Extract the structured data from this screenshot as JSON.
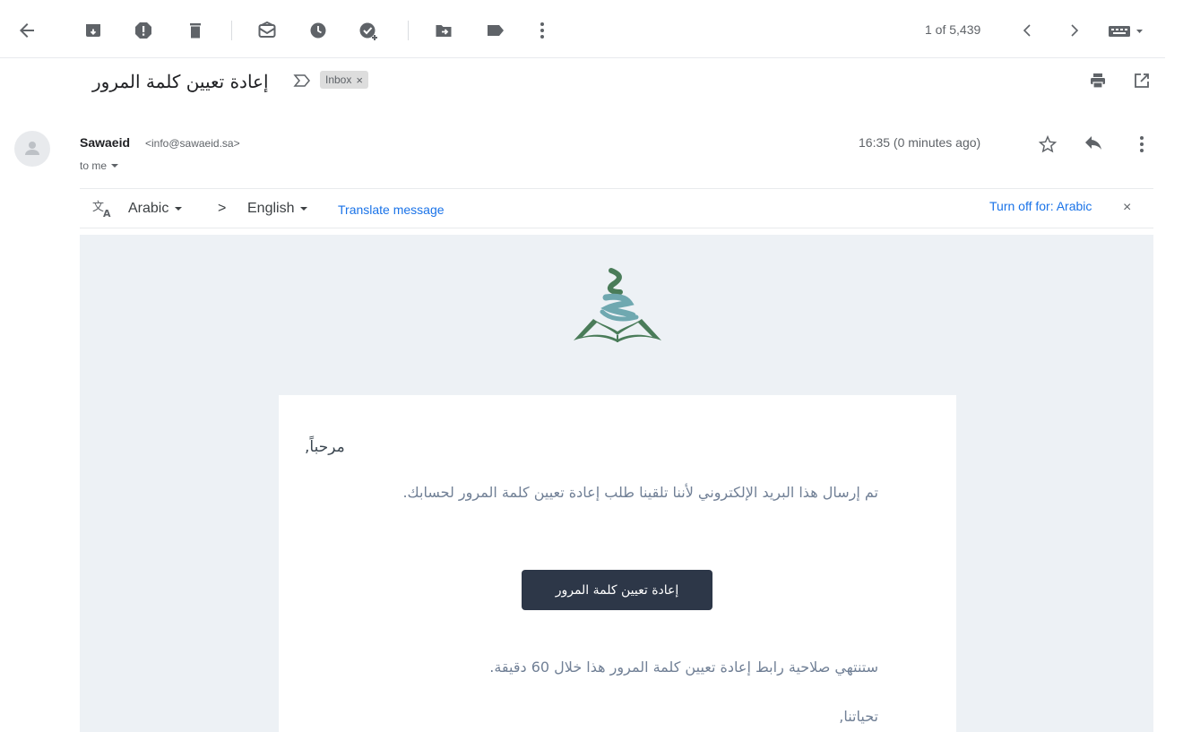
{
  "toolbar": {
    "pagination": "1 of 5,439"
  },
  "subject": {
    "text": "إعادة تعيين كلمة المرور",
    "label_chip": "Inbox",
    "chip_close": "×"
  },
  "message": {
    "sender_name": "Sawaeid",
    "sender_email": "<info@sawaeid.sa>",
    "recipient": "to me",
    "time": "16:35 (0 minutes ago)"
  },
  "translate_bar": {
    "from_lang": "Arabic",
    "arrow": ">",
    "to_lang": "English",
    "translate_link": "Translate message",
    "turn_off": "Turn off for: Arabic",
    "close": "×"
  },
  "email_body": {
    "greeting": "مرحباً,",
    "line1": "تم إرسال هذا البريد الإلكتروني لأننا تلقينا طلب إعادة تعيين كلمة المرور لحسابك.",
    "button_label": "إعادة تعيين كلمة المرور",
    "expiry_text": "ستنتهي صلاحية رابط إعادة تعيين كلمة المرور هذا خلال 60 دقيقة.",
    "signoff": "تحياتنا,"
  },
  "icons": [
    "back-arrow-icon",
    "archive-icon",
    "report-spam-icon",
    "delete-icon",
    "mark-unread-icon",
    "snooze-icon",
    "add-to-tasks-icon",
    "move-to-icon",
    "label-icon",
    "more-vert-icon",
    "chevron-left-icon",
    "chevron-right-icon",
    "keyboard-icon",
    "print-icon",
    "open-new-window-icon",
    "star-icon",
    "reply-icon",
    "translate-icon",
    "importance-marker-icon"
  ],
  "colors": {
    "link_blue": "#1a73e8",
    "email_background": "#edf1f5",
    "button_dark": "#2d3748",
    "logo_green": "#4a7c59",
    "logo_teal": "#6fa8b0"
  }
}
